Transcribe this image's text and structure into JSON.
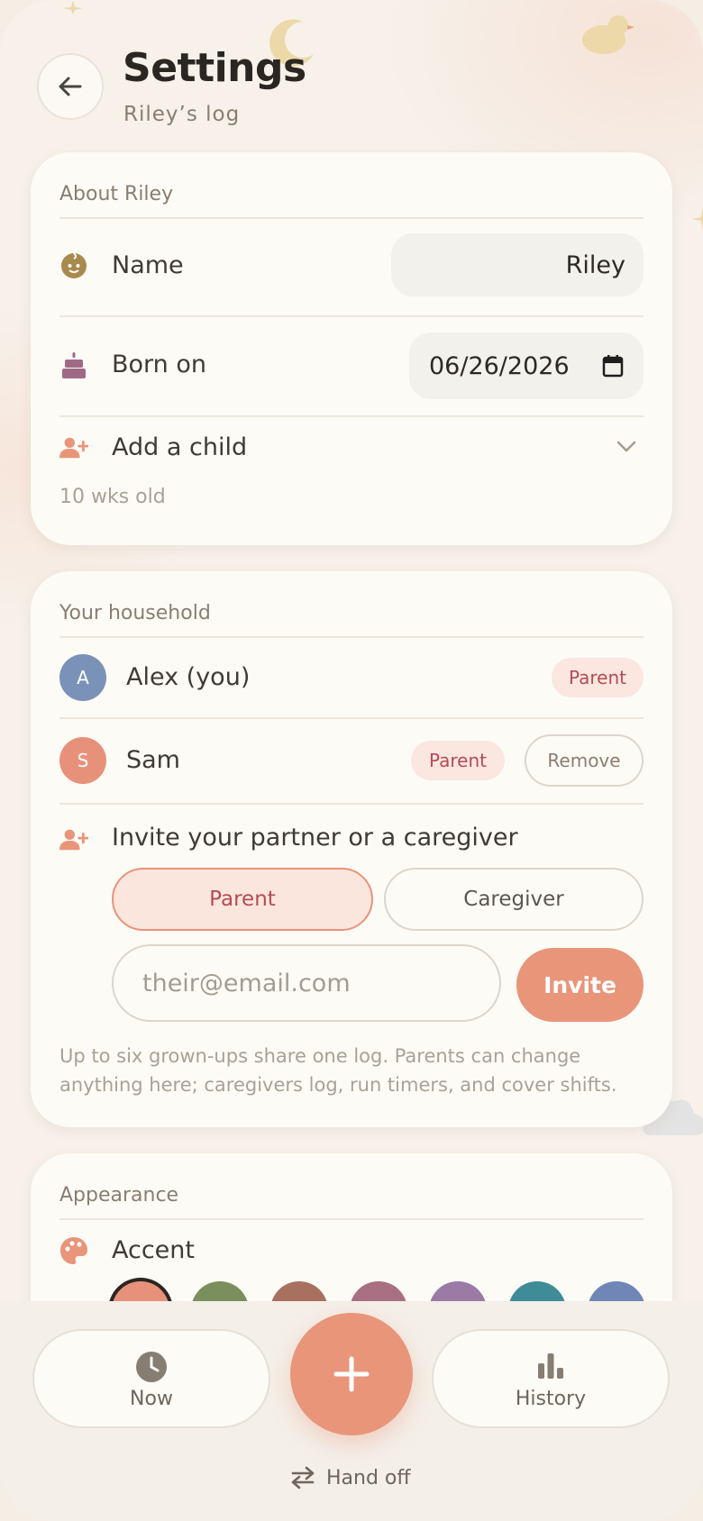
{
  "header": {
    "title": "Settings",
    "subtitle": "Riley’s log"
  },
  "about": {
    "section_title": "About Riley",
    "name_label": "Name",
    "name_value": "Riley",
    "born_label": "Born on",
    "born_value": "06/26/2026",
    "add_child_label": "Add a child",
    "age_text": "10 wks old"
  },
  "household": {
    "section_title": "Your household",
    "members": [
      {
        "initial": "A",
        "name": "Alex (you)",
        "role": "Parent",
        "color": "#7a92b8"
      },
      {
        "initial": "S",
        "name": "Sam",
        "role": "Parent",
        "color": "#e8917a",
        "remove_label": "Remove"
      }
    ],
    "invite_label": "Invite your partner or a caregiver",
    "role_options": [
      "Parent",
      "Caregiver"
    ],
    "selected_role": "Parent",
    "email_placeholder": "their@email.com",
    "invite_button": "Invite",
    "help_text": "Up to six grown-ups share one log. Parents can change anything here; caregivers log, run timers, and cover shifts."
  },
  "appearance": {
    "section_title": "Appearance",
    "accent_label": "Accent",
    "accent_colors": [
      "#e8917a",
      "#7b8f5c",
      "#a8705f",
      "#a87082",
      "#9b7aa6",
      "#3f8c98",
      "#6f86b6"
    ],
    "selected_accent": "#e8917a"
  },
  "nav": {
    "now_label": "Now",
    "history_label": "History",
    "handoff_label": "Hand off"
  }
}
